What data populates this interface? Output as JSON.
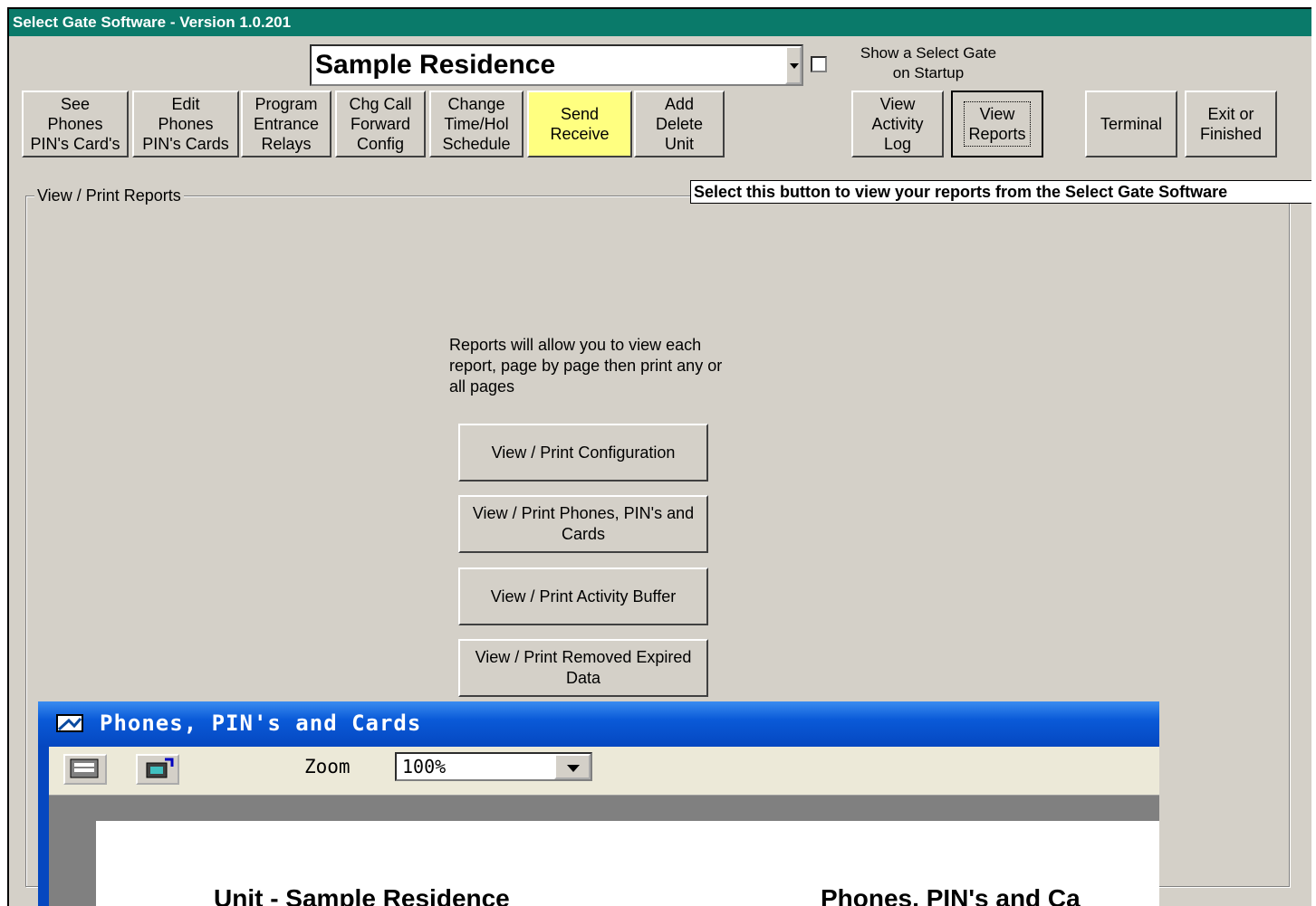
{
  "app": {
    "title": "Select Gate Software - Version 1.0.201"
  },
  "site_selector": {
    "value": "Sample Residence"
  },
  "startup_option": {
    "label": "Show a Select Gate\non Startup",
    "checked": false
  },
  "toolbar": [
    {
      "id": "see-phones",
      "label": "See\nPhones\nPIN's Card's"
    },
    {
      "id": "edit-phones",
      "label": "Edit\nPhones\nPIN's Cards"
    },
    {
      "id": "program-relays",
      "label": "Program\nEntrance\nRelays"
    },
    {
      "id": "chg-call-forward",
      "label": "Chg Call\nForward\nConfig"
    },
    {
      "id": "change-schedule",
      "label": "Change\nTime/Hol\nSchedule"
    },
    {
      "id": "send-receive",
      "label": "Send\nReceive"
    },
    {
      "id": "add-delete-unit",
      "label": "Add\nDelete\nUnit"
    },
    {
      "id": "view-activity-log",
      "label": "View\nActivity\nLog"
    },
    {
      "id": "view-reports",
      "label": "View\nReports"
    },
    {
      "id": "terminal",
      "label": "Terminal"
    },
    {
      "id": "exit",
      "label": "Exit or\nFinished"
    }
  ],
  "tooltip": "Select this button to view your reports from the Select Gate Software",
  "reports_panel": {
    "group_label": "View / Print Reports",
    "description": "Reports  will allow you to view each report, page by page  then print any or all pages",
    "buttons": [
      "View / Print Configuration",
      "View / Print Phones, PIN's and Cards",
      "View / Print Activity Buffer",
      "View / Print Removed Expired Data"
    ]
  },
  "preview_window": {
    "title": "Phones, PIN's and Cards",
    "zoom_label": "Zoom",
    "zoom_value": "100%",
    "page_heading_left": "Unit - Sample Residence",
    "page_heading_right": "Phones, PIN's and Ca"
  },
  "colors": {
    "title_bar": "#0a7a6a",
    "window_bg": "#d4d0c8",
    "send_receive": "#ffff80",
    "preview_title": "#0547c0"
  }
}
